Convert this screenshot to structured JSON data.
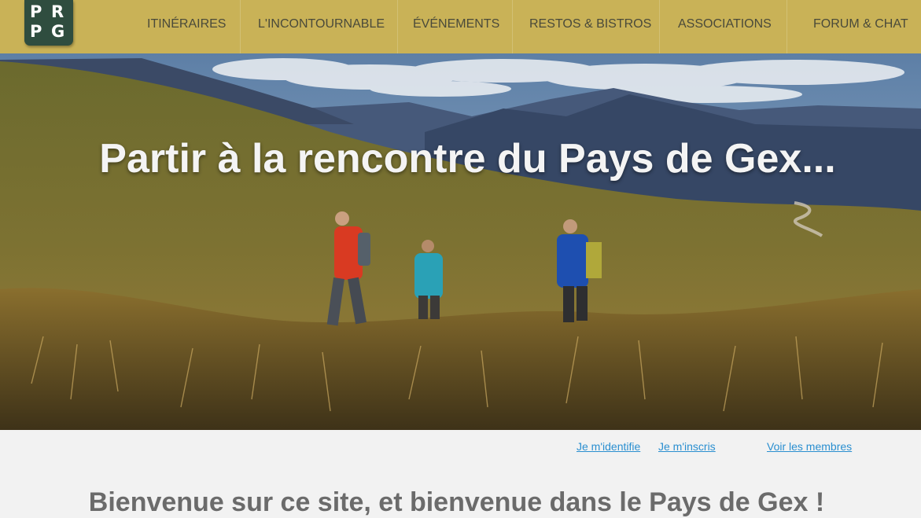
{
  "logo": {
    "text": "PRPG",
    "letters": [
      "P",
      "R",
      "P",
      "G"
    ],
    "background": "#2f4d3f"
  },
  "nav": {
    "background": "#c9b257",
    "items": [
      {
        "label": "ITINÉRAIRES"
      },
      {
        "label": "L'INCONTOURNABLE"
      },
      {
        "label": "ÉVÉNEMENTS"
      },
      {
        "label": "RESTOS & BISTROS"
      },
      {
        "label": "ASSOCIATIONS"
      },
      {
        "label": "FORUM & CHAT"
      }
    ]
  },
  "hero": {
    "title": "Partir à la rencontre du Pays de Gex..."
  },
  "account_links": {
    "login": "Je m'identifie",
    "register": "Je m'inscris",
    "members": "Voir les membres",
    "color": "#2a8fd0"
  },
  "welcome": {
    "heading": "Bienvenue sur ce site, et bienvenue dans le Pays de Gex !"
  }
}
